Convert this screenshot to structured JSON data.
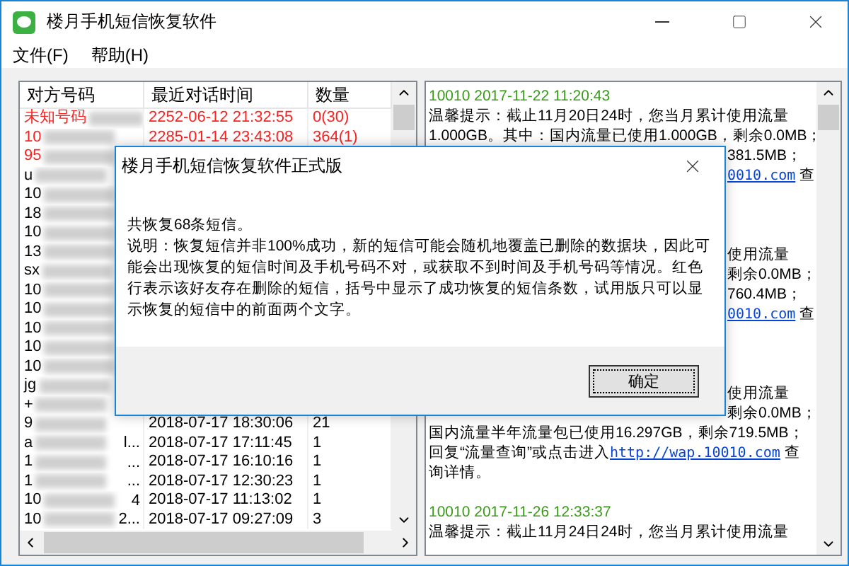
{
  "window": {
    "title": "楼月手机短信恢复软件"
  },
  "menu": [
    "文件(F)",
    "帮助(H)"
  ],
  "contacts": {
    "columns": [
      "对方号码",
      "最近对话时间",
      "数量"
    ],
    "rows": [
      {
        "name": "未知号码",
        "time": "2252-06-12 21:32:55",
        "count": "0(30)",
        "deleted": true
      },
      {
        "name": "10",
        "time": "2285-01-14 23:43:08",
        "count": "364(1)",
        "deleted": true
      },
      {
        "name": "95",
        "deleted": true
      },
      {
        "name": "u",
        "deleted": false
      },
      {
        "name": "10",
        "deleted": false
      },
      {
        "name": "18",
        "deleted": false
      },
      {
        "name": "10",
        "deleted": false
      },
      {
        "name": "13",
        "deleted": false
      },
      {
        "name": "sx",
        "deleted": false
      },
      {
        "name": "10",
        "deleted": false
      },
      {
        "name": "10",
        "deleted": false
      },
      {
        "name": "10",
        "deleted": false
      },
      {
        "name": "10",
        "deleted": false
      },
      {
        "name": "10",
        "deleted": false
      },
      {
        "name": "jg",
        "deleted": false
      },
      {
        "name": "+",
        "deleted": false
      },
      {
        "name": "9",
        "time": "2018-07-17 18:30:06",
        "count": "21",
        "deleted": false
      },
      {
        "name": "a",
        "tail": "l...",
        "time": "2018-07-17 17:11:45",
        "count": "1",
        "deleted": false
      },
      {
        "name": "1",
        "tail": "...",
        "time": "2018-07-17 16:10:16",
        "count": "1",
        "deleted": false
      },
      {
        "name": "1",
        "tail": "...",
        "time": "2018-07-17 12:30:23",
        "count": "1",
        "deleted": false
      },
      {
        "name": "10",
        "tail": "4",
        "time": "2018-07-17 11:13:02",
        "count": "1",
        "deleted": false
      },
      {
        "name": "10",
        "tail": "2...",
        "time": "2018-07-17 09:27:09",
        "count": "3",
        "deleted": false
      }
    ]
  },
  "messages": [
    {
      "kind": "header",
      "parts": [
        {
          "text": "10010 2017-11-22 11:20:43"
        }
      ]
    },
    {
      "kind": "text",
      "parts": [
        {
          "text": "温馨提示：截止11月20日24时，您当月累计使用流量"
        }
      ]
    },
    {
      "kind": "text",
      "parts": [
        {
          "text": "1.000GB。其中：国内流量已使用1.000GB，剩余0.0MB；"
        }
      ]
    },
    {
      "kind": "fragment",
      "parts": [
        {
          "text": "381.5MB；"
        }
      ]
    },
    {
      "kind": "fragment",
      "parts": [
        {
          "text": "0010.com",
          "link": true
        },
        {
          "text": " 查"
        }
      ]
    },
    {
      "kind": "blank"
    },
    {
      "kind": "blank"
    },
    {
      "kind": "blank"
    },
    {
      "kind": "fragment",
      "parts": [
        {
          "text": "使用流量"
        }
      ]
    },
    {
      "kind": "fragment",
      "parts": [
        {
          "text": "剩余0.0MB；"
        }
      ]
    },
    {
      "kind": "fragment",
      "parts": [
        {
          "text": "760.4MB；"
        }
      ]
    },
    {
      "kind": "fragment",
      "parts": [
        {
          "text": "0010.com",
          "link": true
        },
        {
          "text": " 查"
        }
      ]
    },
    {
      "kind": "blank"
    },
    {
      "kind": "blank"
    },
    {
      "kind": "blank"
    },
    {
      "kind": "fragment",
      "parts": [
        {
          "text": "使用流量"
        }
      ]
    },
    {
      "kind": "fragment",
      "parts": [
        {
          "text": "剩余0.0MB；"
        }
      ]
    },
    {
      "kind": "text",
      "parts": [
        {
          "text": "国内流量半年流量包已使用16.297GB，剩余719.5MB；"
        }
      ]
    },
    {
      "kind": "text",
      "parts": [
        {
          "text": "回复“流量查询”或点击进入"
        },
        {
          "text": "http://wap.10010.com",
          "link": true
        },
        {
          "text": " 查"
        }
      ]
    },
    {
      "kind": "text",
      "parts": [
        {
          "text": "询详情。"
        }
      ]
    },
    {
      "kind": "blank"
    },
    {
      "kind": "header",
      "parts": [
        {
          "text": "10010 2017-11-26 12:33:37"
        }
      ]
    },
    {
      "kind": "text",
      "parts": [
        {
          "text": "温馨提示：截止11月24日24时，您当月累计使用流量"
        }
      ]
    }
  ],
  "dialog": {
    "title": "楼月手机短信恢复软件正式版",
    "summary": "共恢复68条短信。",
    "note": "说明：恢复短信并非100%成功，新的短信可能会随机地覆盖已删除的数据块，因此可能会出现恢复的短信时间及手机号码不对，或获取不到时间及手机号码等情况。红色行表示该好友存在删除的短信，括号中显示了成功恢复的短信条数，试用版只可以显示恢复的短信中的前面两个文字。",
    "button": "确定"
  }
}
